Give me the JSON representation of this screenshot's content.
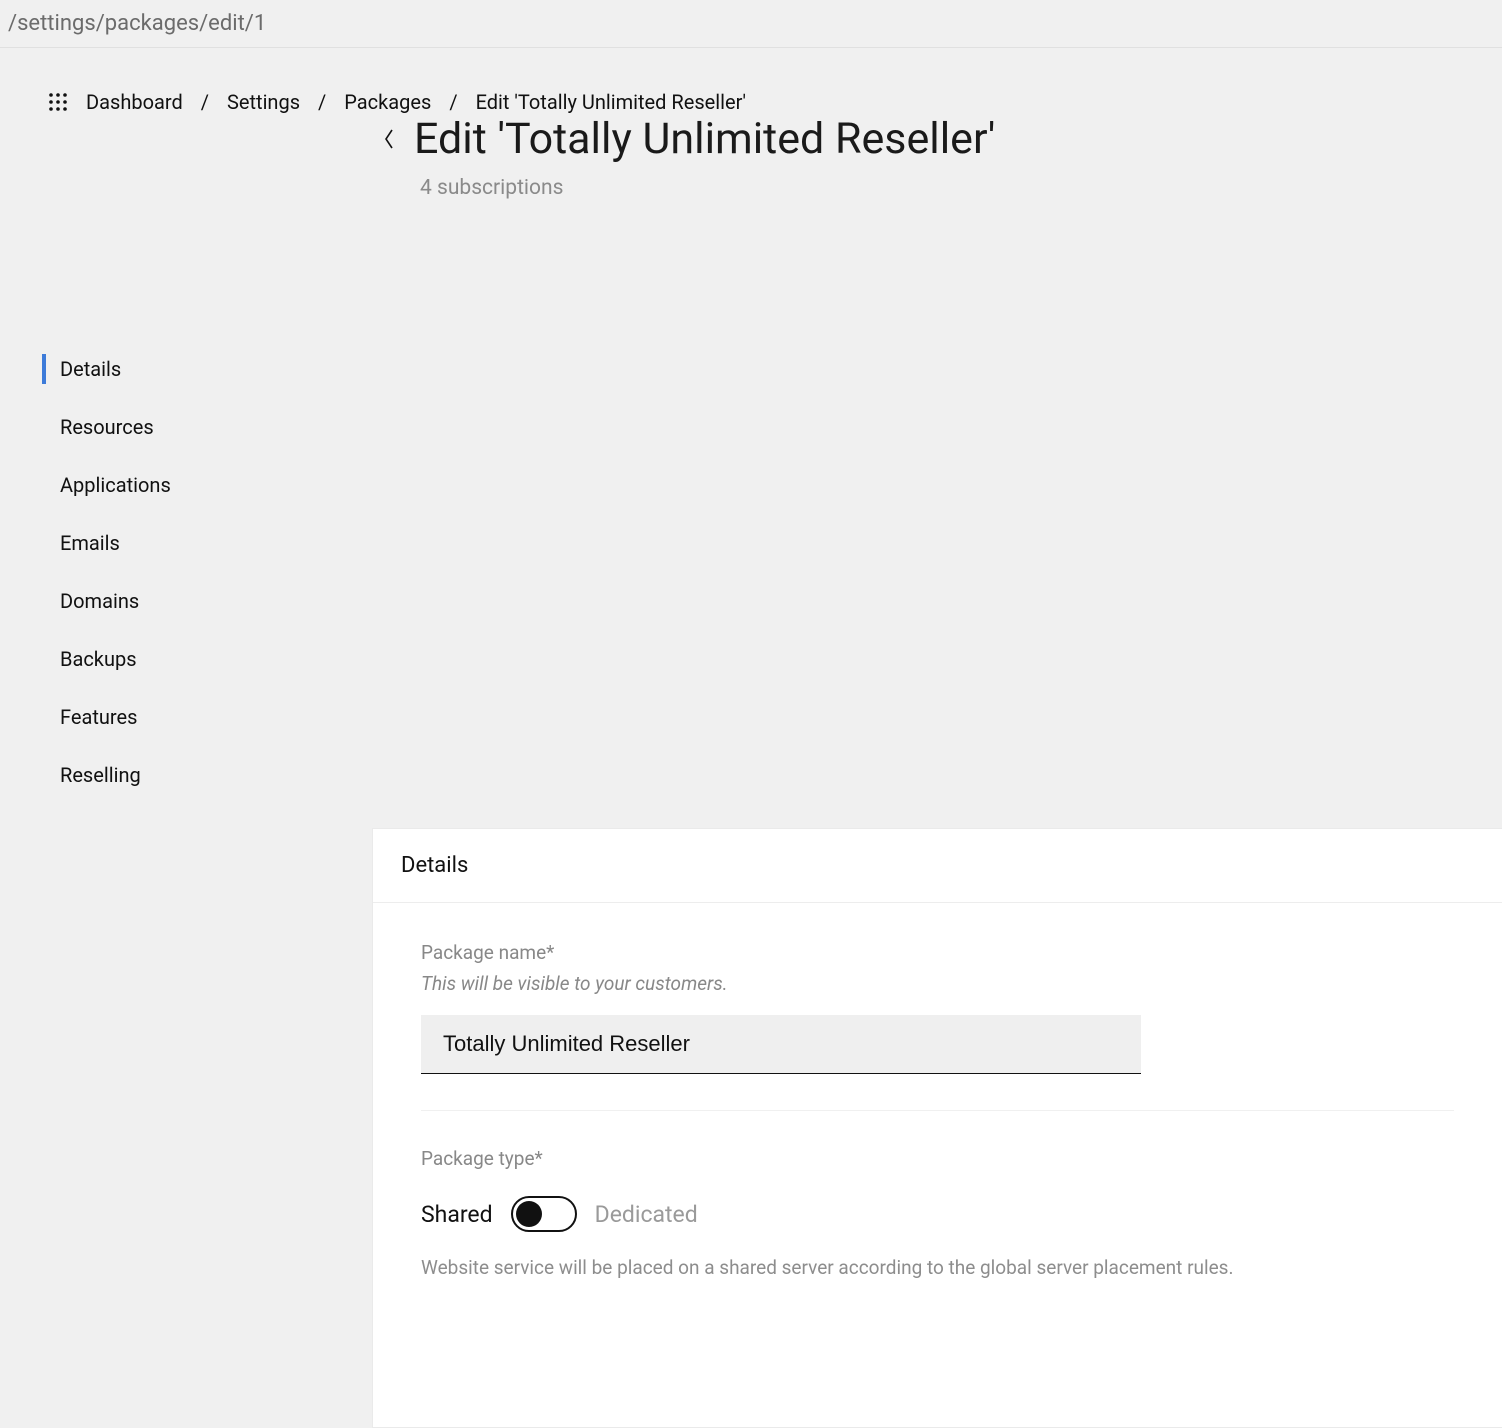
{
  "url_path": "/settings/packages/edit/1",
  "breadcrumb": {
    "items": [
      "Dashboard",
      "Settings",
      "Packages",
      "Edit 'Totally Unlimited Reseller'"
    ]
  },
  "sidebar": {
    "items": [
      {
        "label": "Details",
        "active": true
      },
      {
        "label": "Resources",
        "active": false
      },
      {
        "label": "Applications",
        "active": false
      },
      {
        "label": "Emails",
        "active": false
      },
      {
        "label": "Domains",
        "active": false
      },
      {
        "label": "Backups",
        "active": false
      },
      {
        "label": "Features",
        "active": false
      },
      {
        "label": "Reselling",
        "active": false
      }
    ]
  },
  "header": {
    "title": "Edit 'Totally Unlimited Reseller'",
    "subtitle": "4 subscriptions"
  },
  "panel": {
    "title": "Details",
    "package_name": {
      "label": "Package name*",
      "help": "This will be visible to your customers.",
      "value": "Totally Unlimited Reseller"
    },
    "package_type": {
      "label": "Package type*",
      "option_left": "Shared",
      "option_right": "Dedicated",
      "selected": "Shared",
      "description": "Website service will be placed on a shared server according to the global server placement rules."
    }
  }
}
